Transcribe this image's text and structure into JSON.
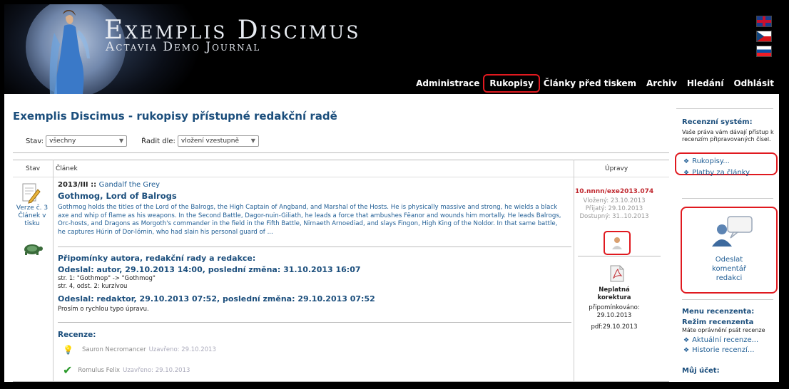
{
  "header": {
    "title": "Exemplis Discimus",
    "subtitle": "Actavia Demo Journal",
    "nav": [
      {
        "label": "Administrace"
      },
      {
        "label": "Rukopisy"
      },
      {
        "label": "Články před tiskem"
      },
      {
        "label": "Archiv"
      },
      {
        "label": "Hledání"
      },
      {
        "label": "Odhlásit"
      }
    ]
  },
  "main": {
    "page_title": "Exemplis Discimus - rukopisy přístupné redakční radě",
    "filter_stav_label": "Stav:",
    "filter_stav_value": "všechny",
    "filter_sort_label": "Řadit dle:",
    "filter_sort_value": "vložení vzestupně",
    "col_stav": "Stav",
    "col_clanek": "Článek",
    "col_upravy": "Úpravy",
    "verze_text": "Verze č. 3 Článek v tisku",
    "article": {
      "issue": "2013/III",
      "sep": " :: ",
      "author": "Gandalf the Grey",
      "title": "Gothmog, Lord of Balrogs",
      "abstract": "Gothmog holds the titles of the Lord of the Balrogs, the High Captain of Angband, and Marshal of the Hosts. He is physically massive and strong, he wields a black axe and whip of flame as his weapons. In the Second Battle, Dagor-nuin-Giliath, he leads a force that ambushes Fëanor and wounds him mortally. He leads Balrogs, Orc-hosts, and Dragons as Morgoth's commander in the field in the Fifth Battle, Nirnaeth Arnoediad, and slays Fingon, High King of the Noldor. In that same battle, he captures Húrin of Dor-lómin, who had slain his personal guard of ..."
    },
    "comments": {
      "heading": "Připomínky autora, redakční rady a redakce:",
      "entry1": "Odeslal: autor, 29.10.2013 14:00, poslední změna: 31.10.2013 16:07",
      "entry1_line1": "str. 1: \"Gothmop\" -> \"Gothmog\"",
      "entry1_line2": "str. 4, odst. 2: kurzívou",
      "entry2": "Odeslal: redaktor, 29.10.2013 07:52, poslední změna: 29.10.2013 07:52",
      "entry2_line1": "Prosím o rychlou typo úpravu."
    },
    "reviews": {
      "title": "Recenze:",
      "items": [
        {
          "name": "Sauron Necromancer",
          "status": "Uzavřeno: 29.10.2013"
        },
        {
          "name": "Romulus Felix",
          "status": "Uzavřeno: 29.10.2013"
        }
      ]
    },
    "upravy": {
      "ms_id": "10.nnnn/exe2013.074",
      "vlozeny": "Vložený: 23.10.2013",
      "prijaty": "Přijatý: 29.10.2013",
      "dostupny": "Dostupný: 31..10.2013",
      "corr_status1": "Neplatná",
      "corr_status2": "korektura",
      "corr_comment": "připomínkováno:",
      "corr_date": "29.10.2013",
      "pdf_date": "pdf:29.10.2013"
    }
  },
  "sidebar": {
    "review_system_title": "Recenzní systém:",
    "review_system_text": "Vaše práva vám dávají přístup k recenzím připravovaných čísel.",
    "link_rukopisy": "Rukopisy...",
    "link_platby": "Platby za články",
    "send_comment": "Odeslat komentář redakci",
    "menu_reviewer_title": "Menu recenzenta:",
    "reviewer_mode_title": "Režim recenzenta",
    "reviewer_mode_text": "Máte oprávnění psát recenze",
    "link_current_reviews": "Aktuální recenze...",
    "link_history_reviews": "Historie recenzí...",
    "my_account_title": "Můj účet:"
  }
}
